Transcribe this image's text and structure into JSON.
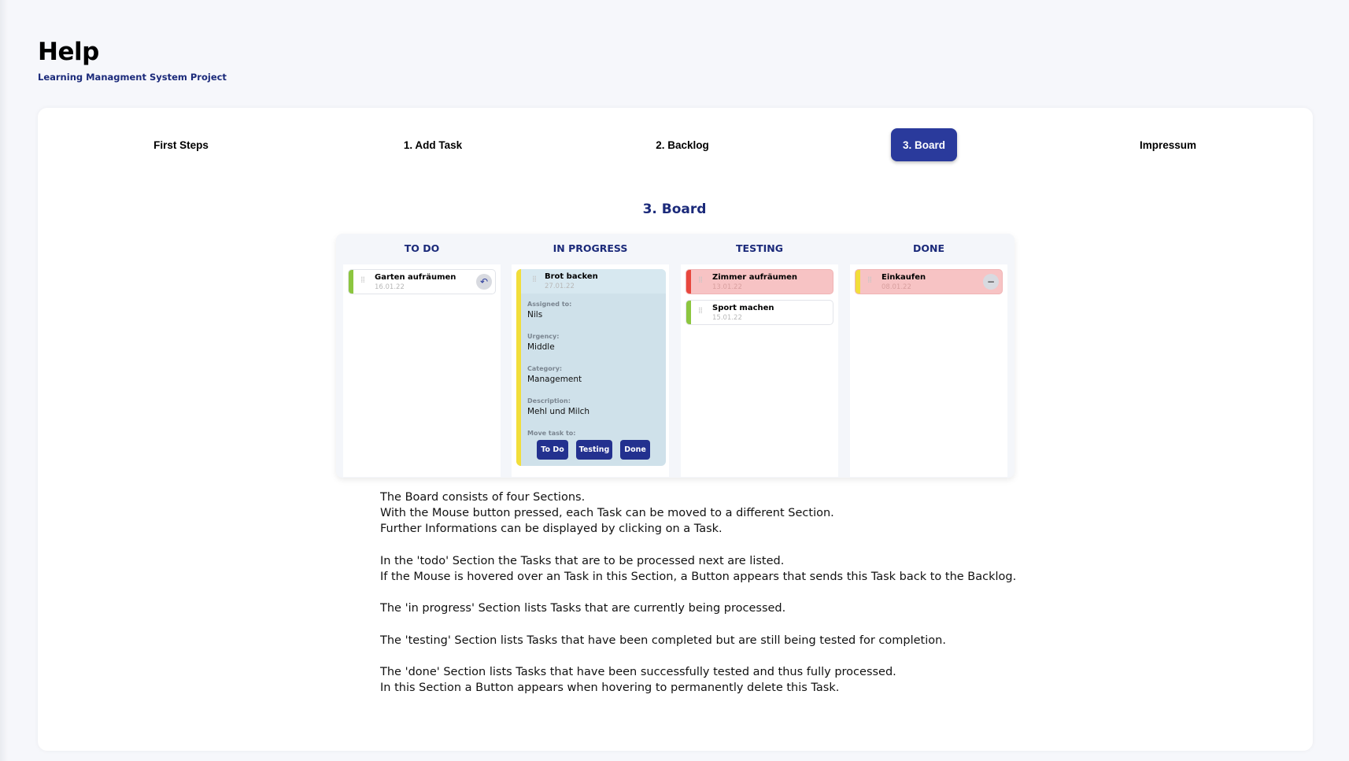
{
  "header": {
    "title": "Help",
    "subtitle": "Learning Managment System Project"
  },
  "tabs": [
    {
      "label": "First Steps",
      "active": false
    },
    {
      "label": "1. Add Task",
      "active": false
    },
    {
      "label": "2. Backlog",
      "active": false
    },
    {
      "label": "3. Board",
      "active": true
    },
    {
      "label": "Impressum",
      "active": false
    }
  ],
  "section": {
    "title": "3. Board"
  },
  "board": {
    "columns": [
      {
        "title": "TO DO"
      },
      {
        "title": "IN PROGRESS"
      },
      {
        "title": "TESTING"
      },
      {
        "title": "DONE"
      }
    ],
    "todo_tasks": [
      {
        "name": "Garten aufräumen",
        "date": "16.01.22",
        "urgency_color": "#8cc63f"
      }
    ],
    "in_progress_task": {
      "name": "Brot backen",
      "date": "27.01.22",
      "urgency_color": "#f2de3a",
      "assigned_label": "Assigned to:",
      "assigned_value": "Nils",
      "urgency_label": "Urgency:",
      "urgency_value": "Middle",
      "category_label": "Category:",
      "category_value": "Management",
      "description_label": "Description:",
      "description_value": "Mehl und Milch",
      "move_label": "Move task to:",
      "move_buttons": [
        "To Do",
        "Testing",
        "Done"
      ]
    },
    "testing_tasks": [
      {
        "name": "Zimmer aufräumen",
        "date": "13.01.22",
        "urgency_color": "#e8473d"
      },
      {
        "name": "Sport machen",
        "date": "15.01.22",
        "urgency_color": "#8cc63f"
      }
    ],
    "done_tasks": [
      {
        "name": "Einkaufen",
        "date": "08.01.22",
        "urgency_color": "#f2de3a"
      }
    ]
  },
  "description": {
    "lines": [
      "The Board consists of four Sections.",
      "With the Mouse button pressed, each Task can be moved to a different Section.",
      "Further Informations can be displayed by clicking on a Task.",
      "",
      "In the 'todo' Section the Tasks that are to be processed next are listed.",
      "If the Mouse is hovered over an Task in this Section, a Button appears that sends this Task back to the Backlog.",
      "",
      "The 'in progress' Section lists Tasks that are currently being processed.",
      "",
      "The 'testing' Section lists Tasks that have been completed but are still being tested for completion.",
      "",
      "The 'done' Section lists Tasks that have been successfully tested and thus fully processed.",
      "In this Section a Button appears when hovering to permanently delete this Task."
    ]
  },
  "colors": {
    "accent": "#2a3a9c",
    "heading": "#1b2a7a",
    "page_bg": "#f6f7fb",
    "urgent_bg": "#f7c3c4",
    "detail_bg": "#cfe1ea"
  }
}
